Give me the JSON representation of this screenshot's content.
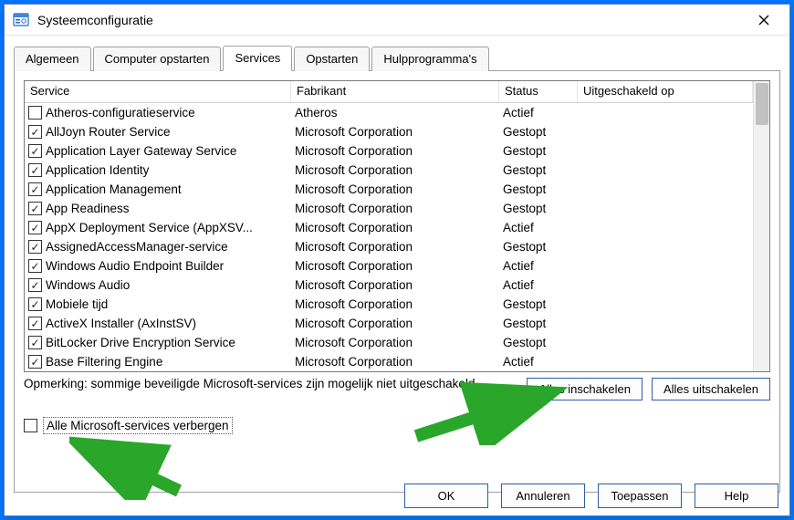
{
  "window": {
    "title": "Systeemconfiguratie"
  },
  "tabs": {
    "items": [
      {
        "label": "Algemeen"
      },
      {
        "label": "Computer opstarten"
      },
      {
        "label": "Services",
        "active": true
      },
      {
        "label": "Opstarten"
      },
      {
        "label": "Hulpprogramma's"
      }
    ]
  },
  "columns": {
    "service": "Service",
    "manufacturer": "Fabrikant",
    "status": "Status",
    "disabledOn": "Uitgeschakeld op"
  },
  "services": [
    {
      "checked": false,
      "name": "Atheros-configuratieservice",
      "manufacturer": "Atheros",
      "status": "Actief"
    },
    {
      "checked": true,
      "name": "AllJoyn Router Service",
      "manufacturer": "Microsoft Corporation",
      "status": "Gestopt"
    },
    {
      "checked": true,
      "name": "Application Layer Gateway Service",
      "manufacturer": "Microsoft Corporation",
      "status": "Gestopt"
    },
    {
      "checked": true,
      "name": "Application Identity",
      "manufacturer": "Microsoft Corporation",
      "status": "Gestopt"
    },
    {
      "checked": true,
      "name": "Application Management",
      "manufacturer": "Microsoft Corporation",
      "status": "Gestopt"
    },
    {
      "checked": true,
      "name": "App Readiness",
      "manufacturer": "Microsoft Corporation",
      "status": "Gestopt"
    },
    {
      "checked": true,
      "name": "AppX Deployment Service (AppXSV...",
      "manufacturer": "Microsoft Corporation",
      "status": "Actief"
    },
    {
      "checked": true,
      "name": "AssignedAccessManager-service",
      "manufacturer": "Microsoft Corporation",
      "status": "Gestopt"
    },
    {
      "checked": true,
      "name": "Windows Audio Endpoint Builder",
      "manufacturer": "Microsoft Corporation",
      "status": "Actief"
    },
    {
      "checked": true,
      "name": "Windows Audio",
      "manufacturer": "Microsoft Corporation",
      "status": "Actief"
    },
    {
      "checked": true,
      "name": "Mobiele tijd",
      "manufacturer": "Microsoft Corporation",
      "status": "Gestopt"
    },
    {
      "checked": true,
      "name": "ActiveX Installer (AxInstSV)",
      "manufacturer": "Microsoft Corporation",
      "status": "Gestopt"
    },
    {
      "checked": true,
      "name": "BitLocker Drive Encryption Service",
      "manufacturer": "Microsoft Corporation",
      "status": "Gestopt"
    },
    {
      "checked": true,
      "name": "Base Filtering Engine",
      "manufacturer": "Microsoft Corporation",
      "status": "Actief"
    }
  ],
  "note": "Opmerking: sommige beveiligde Microsoft-services zijn mogelijk niet uitgeschakeld.",
  "buttons": {
    "enableAll": "Alles inschakelen",
    "disableAll": "Alles uitschakelen",
    "ok": "OK",
    "cancel": "Annuleren",
    "apply": "Toepassen",
    "help": "Help"
  },
  "hideMs": {
    "checked": false,
    "label": "Alle Microsoft-services verbergen"
  }
}
